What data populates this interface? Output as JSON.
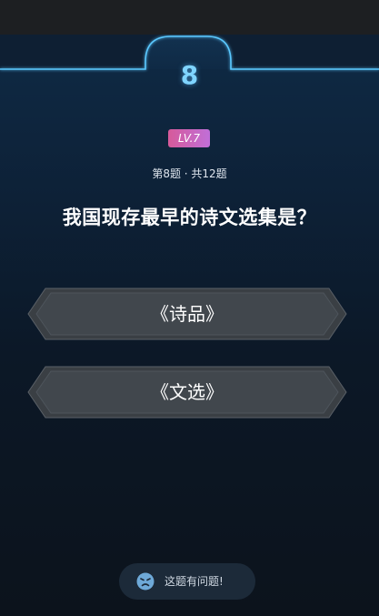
{
  "quiz": {
    "round_number": "8",
    "level_badge": "LV.7",
    "progress_text": "第8题 · 共12题",
    "question": "我国现存最早的诗文选集是？",
    "options": [
      {
        "label": "《诗品》"
      },
      {
        "label": "《文选》"
      }
    ],
    "report_label": "这题有问题!"
  },
  "icons": {
    "report": "frowning-face-icon"
  },
  "colors": {
    "accent_glow": "#5ac8ff",
    "badge_start": "#d65a9a",
    "badge_end": "#c06fd8",
    "option_fill": "#3c4146",
    "panel_top": "#0f2a45",
    "panel_bottom": "#0c131c"
  }
}
